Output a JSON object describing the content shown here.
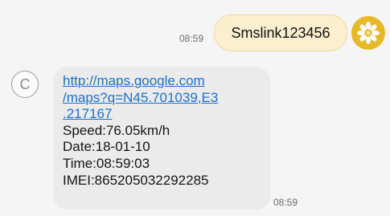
{
  "outgoing": {
    "time": "08:59",
    "text": "Smslink123456",
    "avatar_icon": "sun-flower-icon",
    "bubble_color": "#fbefcf",
    "avatar_color": "#e8b826"
  },
  "incoming": {
    "avatar_letter": "C",
    "link_lines": [
      "http://maps.google.com",
      "/maps?q=N45.701039,E3",
      ".217167"
    ],
    "lines": [
      "Speed:76.05km/h",
      "Date:18-01-10",
      "Time:08:59:03",
      "IMEI:865205032292285"
    ],
    "time": "08:59",
    "link_color": "#1b6fd0",
    "bubble_color": "#ebebeb"
  }
}
